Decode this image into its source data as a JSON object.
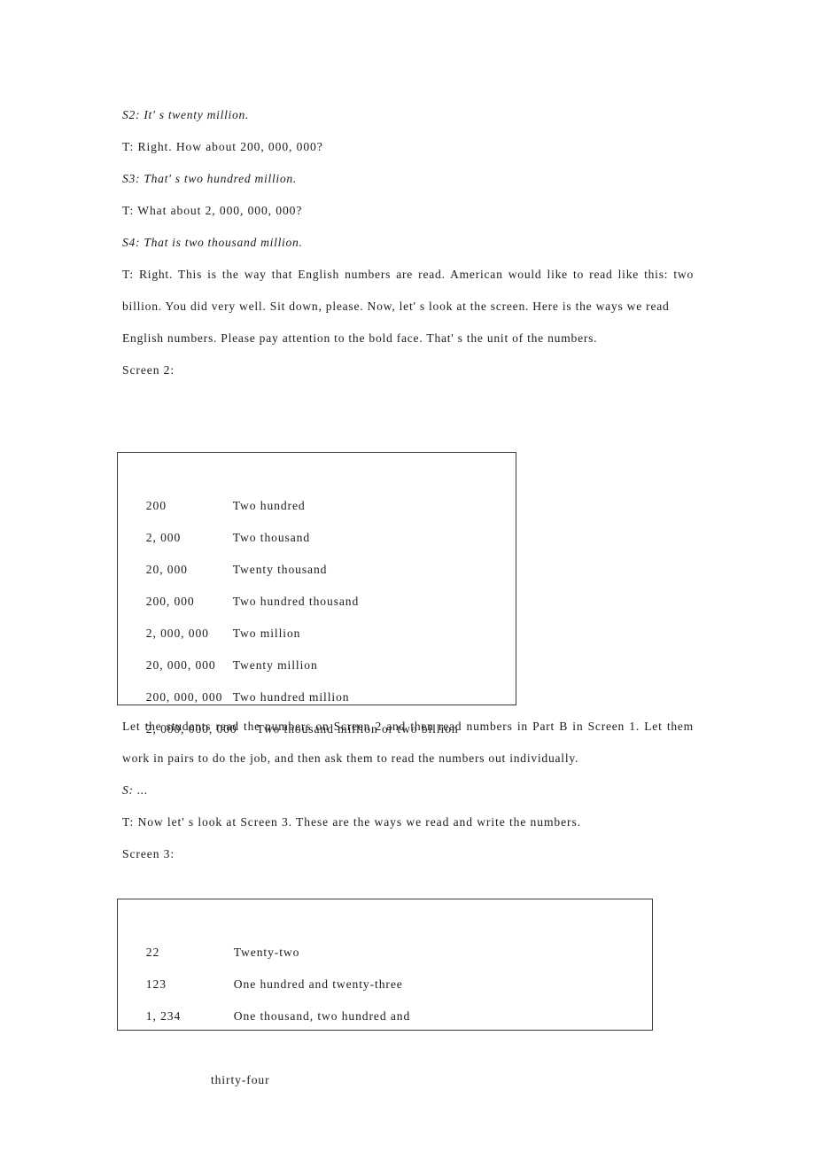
{
  "document": {
    "type": "lesson-plan-transcript",
    "lines": [
      {
        "id": "l1",
        "style": "italic",
        "text": "S2: It' s twenty million."
      },
      {
        "id": "l2",
        "style": "normal",
        "text": "T: Right. How about 200,000,000?"
      },
      {
        "id": "l3",
        "style": "italic",
        "text": "S3: That' s two hundred million."
      },
      {
        "id": "l4",
        "style": "normal",
        "text": "T: What about 2,000,000,000?"
      },
      {
        "id": "l5",
        "style": "italic",
        "text": "S4: That is two thousand million."
      }
    ],
    "paragraph_1": "T: Right. This is the way that English numbers are read. American would like to read like this: two billion. You did very well. Sit down, please. Now, let' s look at the screen. Here is the ways we read",
    "paragraph_2": "English numbers. Please pay attention to the bold face. That' s the unit of the numbers.",
    "screen2_label": "Screen 2:",
    "screen2_rows": [
      {
        "number": "200",
        "words": "Two hundred"
      },
      {
        "number": "2,000",
        "words": "Two thousand"
      },
      {
        "number": "20,000",
        "words": "Twenty thousand"
      },
      {
        "number": "200,000",
        "words": "Two hundred thousand"
      },
      {
        "number": "2,000,000",
        "words": "Two million"
      },
      {
        "number": "20,000,000",
        "words": "Twenty million"
      },
      {
        "number": "200,000,000",
        "words": "Two hundred million"
      },
      {
        "number": "2,000,000,000",
        "words": "Two thousand million or two billion"
      }
    ],
    "paragraph_3": "Let the students read the numbers on Screen 2 and then read numbers in Part B in Screen 1. Let them work in pairs to do the job, and then ask them to read the numbers out individually.",
    "line_student": "S: ...",
    "line_teacher": "T: Now let' s look at Screen 3. These are the ways we read and write the numbers.",
    "screen3_label": "Screen 3:",
    "screen3_rows": [
      {
        "number": "22",
        "words": "Twenty-two",
        "words_line2": ""
      },
      {
        "number": "123",
        "words": "One hundred and twenty-three",
        "words_line2": ""
      },
      {
        "number": "1,234",
        "words": "One thousand, two hundred and",
        "words_line2": "thirty-four"
      }
    ]
  },
  "colors": {
    "page_background": "#ffffff",
    "text": "#1c1c1c",
    "table_border": "#3a3a3a"
  }
}
